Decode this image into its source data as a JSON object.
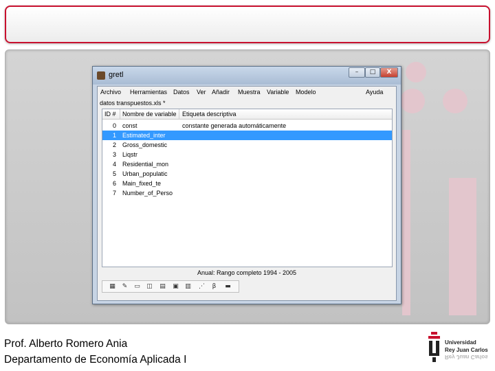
{
  "slide": {
    "footer_line1": "Prof. Alberto Romero Ania",
    "footer_line2": "Departamento de Economía Aplicada I",
    "logo_line1": "Universidad",
    "logo_line2": "Rey Juan Carlos",
    "logo_line3": "Rey Juan Carlos",
    "brand_color": "#c8102e"
  },
  "window": {
    "title": "gretl",
    "buttons": {
      "minimize": "–",
      "maximize": "□",
      "close": "X"
    }
  },
  "menu": [
    "Archivo",
    "Herramientas",
    "Datos",
    "Ver",
    "Añadir",
    "Muestra",
    "Variable",
    "Modelo",
    "Ayuda"
  ],
  "file_label": "datos transpuestos.xls *",
  "table": {
    "headers": [
      "ID #",
      "Nombre de variable",
      "Etiqueta descriptiva"
    ],
    "rows": [
      {
        "id": "0",
        "name": "const",
        "label": "constante generada automáticamente",
        "selected": false
      },
      {
        "id": "1",
        "name": "Estimated_inter",
        "label": "",
        "selected": true
      },
      {
        "id": "2",
        "name": "Gross_domestic",
        "label": "",
        "selected": false
      },
      {
        "id": "3",
        "name": "Liqstr",
        "label": "",
        "selected": false
      },
      {
        "id": "4",
        "name": "Residential_mon",
        "label": "",
        "selected": false
      },
      {
        "id": "5",
        "name": "Urban_populatic",
        "label": "",
        "selected": false
      },
      {
        "id": "6",
        "name": "Main_fixed_te",
        "label": "",
        "selected": false
      },
      {
        "id": "7",
        "name": "Number_of_Perso",
        "label": "",
        "selected": false
      }
    ]
  },
  "status": "Anual: Rango completo 1994 - 2005",
  "toolbar_icons": [
    "calculator-icon",
    "edit-icon",
    "terminal-icon",
    "session-icon",
    "table-icon",
    "pdf-icon",
    "graph-icon",
    "scatter-icon",
    "beta-icon",
    "folder-icon"
  ],
  "toolbar_glyphs": [
    "▦",
    "✎",
    "▭",
    "◫",
    "▤",
    "▣",
    "▥",
    "⋰",
    "β",
    "▬"
  ]
}
